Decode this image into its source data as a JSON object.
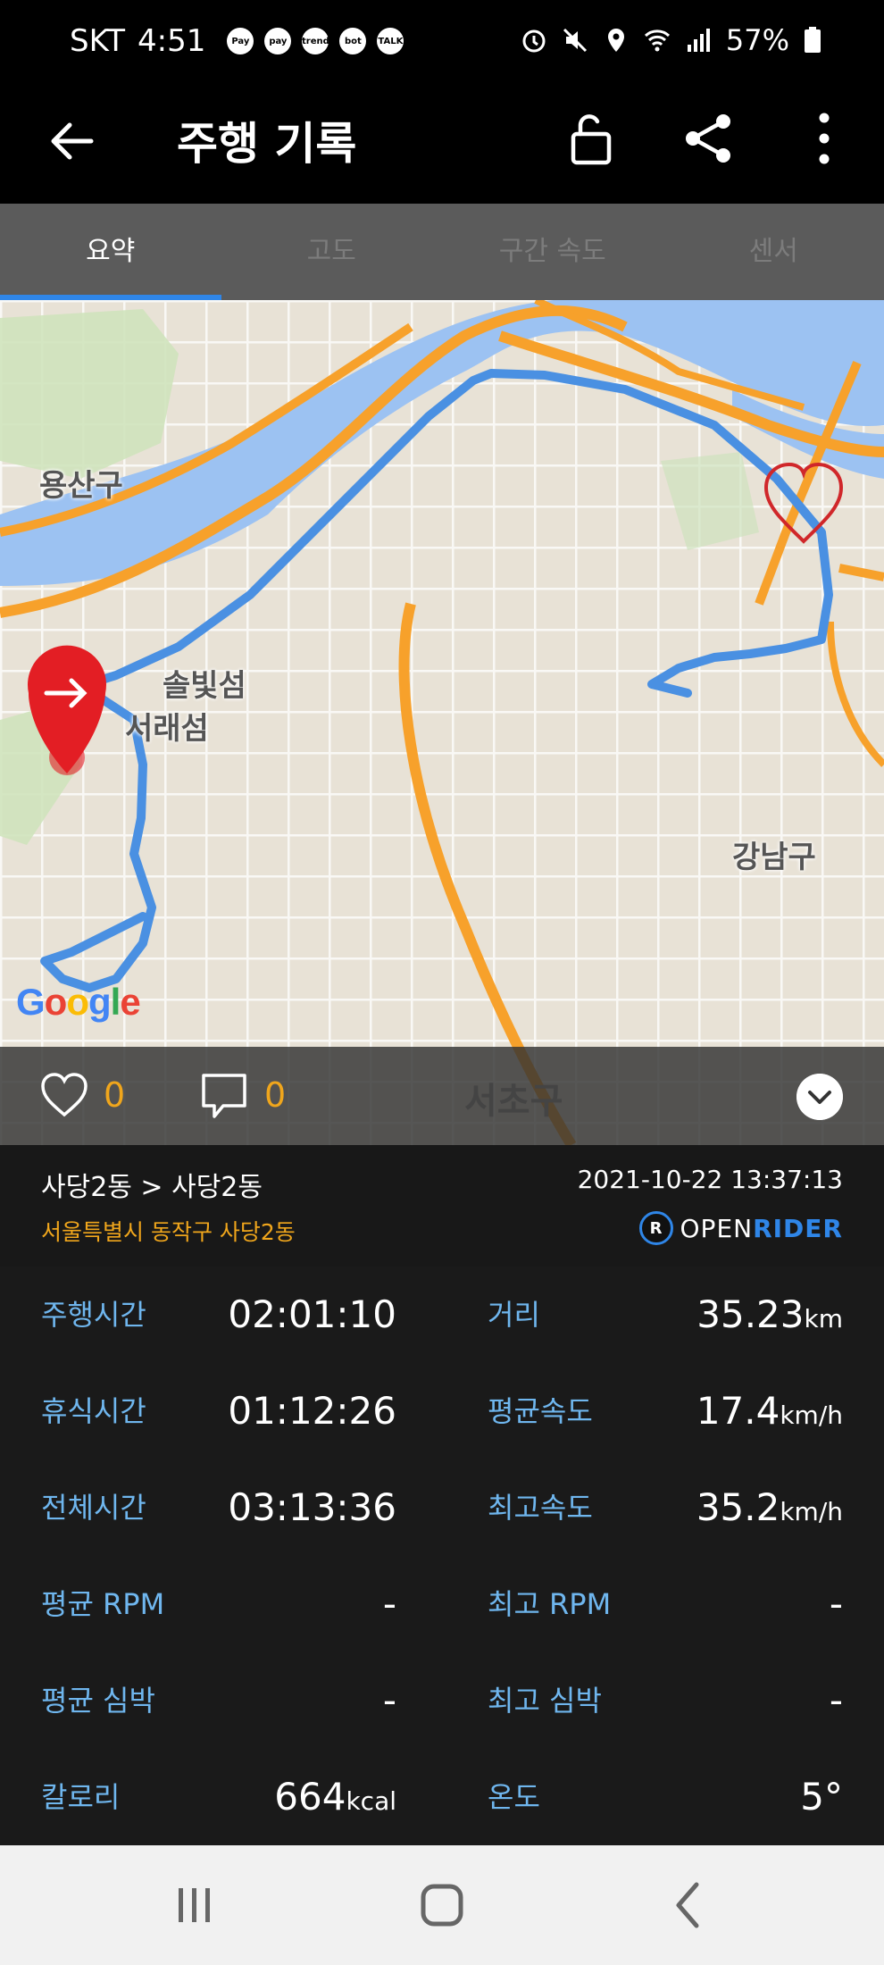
{
  "status_bar": {
    "carrier": "SKT",
    "time": "4:51",
    "notifications": [
      "Pay",
      "pay",
      "trend",
      "bot",
      "TALK"
    ],
    "battery": "57%"
  },
  "app_bar": {
    "title": "주행 기록"
  },
  "tabs": [
    {
      "label": "요약",
      "active": true
    },
    {
      "label": "고도",
      "active": false
    },
    {
      "label": "구간 속도",
      "active": false
    },
    {
      "label": "센서",
      "active": false
    }
  ],
  "map": {
    "labels": {
      "yongsan": "용산구",
      "sebitseom_1": "솔빛섬",
      "sebitseom_2": "서래섬",
      "gangnam": "강남구",
      "seocho": "서초구"
    },
    "google": "Google",
    "route_color": "#4a90e2",
    "road_color": "#f7a12b",
    "river_color": "#9cc2f2"
  },
  "social": {
    "likes": "0",
    "comments": "0"
  },
  "ride_info": {
    "route": "사당2동 > 사당2동",
    "address": "서울특별시 동작구 사당2동",
    "datetime": "2021-10-22 13:37:13",
    "brand_open": "OPEN",
    "brand_rider": "RIDER"
  },
  "stats": {
    "riding_time": {
      "label": "주행시간",
      "value": "02:01:10"
    },
    "distance": {
      "label": "거리",
      "value": "35.23",
      "unit": "km"
    },
    "rest_time": {
      "label": "휴식시간",
      "value": "01:12:26"
    },
    "avg_speed": {
      "label": "평균속도",
      "value": "17.4",
      "unit": "km/h"
    },
    "total_time": {
      "label": "전체시간",
      "value": "03:13:36"
    },
    "max_speed": {
      "label": "최고속도",
      "value": "35.2",
      "unit": "km/h"
    },
    "avg_rpm": {
      "label": "평균 RPM",
      "value": "-"
    },
    "max_rpm": {
      "label": "최고 RPM",
      "value": "-"
    },
    "avg_hr": {
      "label": "평균 심박",
      "value": "-"
    },
    "max_hr": {
      "label": "최고 심박",
      "value": "-"
    },
    "calories": {
      "label": "칼로리",
      "value": "664",
      "unit": "kcal"
    },
    "temperature": {
      "label": "온도",
      "value": "5°"
    }
  }
}
